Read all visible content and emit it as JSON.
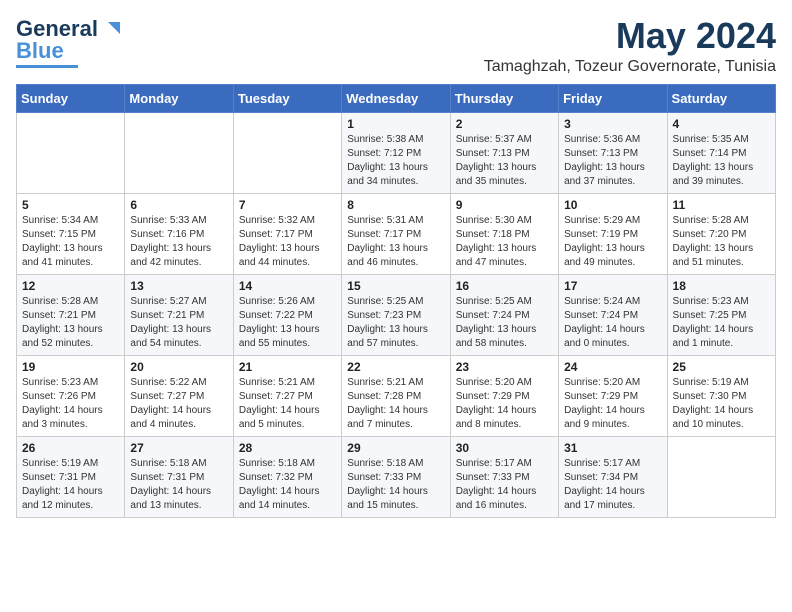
{
  "header": {
    "logo_general": "General",
    "logo_blue": "Blue",
    "month_year": "May 2024",
    "location": "Tamaghzah, Tozeur Governorate, Tunisia"
  },
  "days_of_week": [
    "Sunday",
    "Monday",
    "Tuesday",
    "Wednesday",
    "Thursday",
    "Friday",
    "Saturday"
  ],
  "weeks": [
    [
      {
        "day": "",
        "content": ""
      },
      {
        "day": "",
        "content": ""
      },
      {
        "day": "",
        "content": ""
      },
      {
        "day": "1",
        "content": "Sunrise: 5:38 AM\nSunset: 7:12 PM\nDaylight: 13 hours\nand 34 minutes."
      },
      {
        "day": "2",
        "content": "Sunrise: 5:37 AM\nSunset: 7:13 PM\nDaylight: 13 hours\nand 35 minutes."
      },
      {
        "day": "3",
        "content": "Sunrise: 5:36 AM\nSunset: 7:13 PM\nDaylight: 13 hours\nand 37 minutes."
      },
      {
        "day": "4",
        "content": "Sunrise: 5:35 AM\nSunset: 7:14 PM\nDaylight: 13 hours\nand 39 minutes."
      }
    ],
    [
      {
        "day": "5",
        "content": "Sunrise: 5:34 AM\nSunset: 7:15 PM\nDaylight: 13 hours\nand 41 minutes."
      },
      {
        "day": "6",
        "content": "Sunrise: 5:33 AM\nSunset: 7:16 PM\nDaylight: 13 hours\nand 42 minutes."
      },
      {
        "day": "7",
        "content": "Sunrise: 5:32 AM\nSunset: 7:17 PM\nDaylight: 13 hours\nand 44 minutes."
      },
      {
        "day": "8",
        "content": "Sunrise: 5:31 AM\nSunset: 7:17 PM\nDaylight: 13 hours\nand 46 minutes."
      },
      {
        "day": "9",
        "content": "Sunrise: 5:30 AM\nSunset: 7:18 PM\nDaylight: 13 hours\nand 47 minutes."
      },
      {
        "day": "10",
        "content": "Sunrise: 5:29 AM\nSunset: 7:19 PM\nDaylight: 13 hours\nand 49 minutes."
      },
      {
        "day": "11",
        "content": "Sunrise: 5:28 AM\nSunset: 7:20 PM\nDaylight: 13 hours\nand 51 minutes."
      }
    ],
    [
      {
        "day": "12",
        "content": "Sunrise: 5:28 AM\nSunset: 7:21 PM\nDaylight: 13 hours\nand 52 minutes."
      },
      {
        "day": "13",
        "content": "Sunrise: 5:27 AM\nSunset: 7:21 PM\nDaylight: 13 hours\nand 54 minutes."
      },
      {
        "day": "14",
        "content": "Sunrise: 5:26 AM\nSunset: 7:22 PM\nDaylight: 13 hours\nand 55 minutes."
      },
      {
        "day": "15",
        "content": "Sunrise: 5:25 AM\nSunset: 7:23 PM\nDaylight: 13 hours\nand 57 minutes."
      },
      {
        "day": "16",
        "content": "Sunrise: 5:25 AM\nSunset: 7:24 PM\nDaylight: 13 hours\nand 58 minutes."
      },
      {
        "day": "17",
        "content": "Sunrise: 5:24 AM\nSunset: 7:24 PM\nDaylight: 14 hours\nand 0 minutes."
      },
      {
        "day": "18",
        "content": "Sunrise: 5:23 AM\nSunset: 7:25 PM\nDaylight: 14 hours\nand 1 minute."
      }
    ],
    [
      {
        "day": "19",
        "content": "Sunrise: 5:23 AM\nSunset: 7:26 PM\nDaylight: 14 hours\nand 3 minutes."
      },
      {
        "day": "20",
        "content": "Sunrise: 5:22 AM\nSunset: 7:27 PM\nDaylight: 14 hours\nand 4 minutes."
      },
      {
        "day": "21",
        "content": "Sunrise: 5:21 AM\nSunset: 7:27 PM\nDaylight: 14 hours\nand 5 minutes."
      },
      {
        "day": "22",
        "content": "Sunrise: 5:21 AM\nSunset: 7:28 PM\nDaylight: 14 hours\nand 7 minutes."
      },
      {
        "day": "23",
        "content": "Sunrise: 5:20 AM\nSunset: 7:29 PM\nDaylight: 14 hours\nand 8 minutes."
      },
      {
        "day": "24",
        "content": "Sunrise: 5:20 AM\nSunset: 7:29 PM\nDaylight: 14 hours\nand 9 minutes."
      },
      {
        "day": "25",
        "content": "Sunrise: 5:19 AM\nSunset: 7:30 PM\nDaylight: 14 hours\nand 10 minutes."
      }
    ],
    [
      {
        "day": "26",
        "content": "Sunrise: 5:19 AM\nSunset: 7:31 PM\nDaylight: 14 hours\nand 12 minutes."
      },
      {
        "day": "27",
        "content": "Sunrise: 5:18 AM\nSunset: 7:31 PM\nDaylight: 14 hours\nand 13 minutes."
      },
      {
        "day": "28",
        "content": "Sunrise: 5:18 AM\nSunset: 7:32 PM\nDaylight: 14 hours\nand 14 minutes."
      },
      {
        "day": "29",
        "content": "Sunrise: 5:18 AM\nSunset: 7:33 PM\nDaylight: 14 hours\nand 15 minutes."
      },
      {
        "day": "30",
        "content": "Sunrise: 5:17 AM\nSunset: 7:33 PM\nDaylight: 14 hours\nand 16 minutes."
      },
      {
        "day": "31",
        "content": "Sunrise: 5:17 AM\nSunset: 7:34 PM\nDaylight: 14 hours\nand 17 minutes."
      },
      {
        "day": "",
        "content": ""
      }
    ]
  ]
}
